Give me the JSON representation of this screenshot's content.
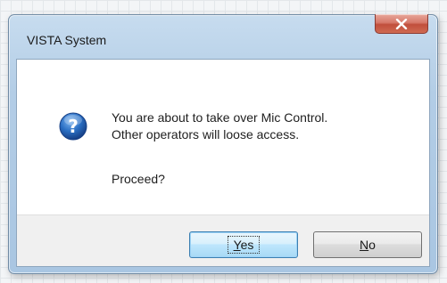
{
  "window": {
    "title": "VISTA System"
  },
  "message": {
    "line1": "You are about to take over Mic Control.",
    "line2": "Other operators will loose access.",
    "prompt": "Proceed?",
    "icon": "question-icon"
  },
  "buttons": {
    "yes": {
      "mnemonic": "Y",
      "rest": "es"
    },
    "no": {
      "mnemonic": "N",
      "rest": "o"
    }
  },
  "colors": {
    "close_button": "#c9584a",
    "default_button_border": "#3c7fb1",
    "icon_blue": "#1e5fb0"
  }
}
